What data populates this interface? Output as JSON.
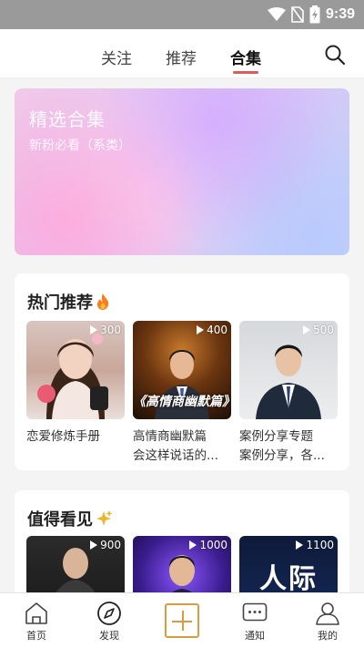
{
  "status_bar": {
    "time": "9:39"
  },
  "top_nav": {
    "tabs": [
      {
        "label": "关注"
      },
      {
        "label": "推荐"
      },
      {
        "label": "合集"
      }
    ],
    "active_tab": "合集"
  },
  "banner": {
    "title": "精选合集",
    "subtitle": "新粉必看（系类）"
  },
  "sections": [
    {
      "title": "热门推荐",
      "title_icon": "fire-icon",
      "items": [
        {
          "count": "300",
          "caption_line1": "恋爱修炼手册",
          "caption_line2": ""
        },
        {
          "count": "400",
          "caption_line1": "高情商幽默篇",
          "caption_line2": "会这样说话的...",
          "thumb_text": "《高情商幽默篇》"
        },
        {
          "count": "500",
          "caption_line1": "案例分享专题",
          "caption_line2": "案例分享，各..."
        }
      ]
    },
    {
      "title": "值得看见",
      "title_icon": "sparkle-icon",
      "items": [
        {
          "count": "900"
        },
        {
          "count": "1000"
        },
        {
          "count": "1100",
          "thumb_text": "人际"
        }
      ]
    }
  ],
  "bottom_nav": [
    {
      "label": "首页",
      "icon": "home-icon"
    },
    {
      "label": "发现",
      "icon": "compass-icon"
    },
    {
      "label": "",
      "icon": "plus-icon"
    },
    {
      "label": "通知",
      "icon": "message-icon"
    },
    {
      "label": "我的",
      "icon": "profile-icon"
    }
  ],
  "colors": {
    "accent": "#e05a5a",
    "plus": "#d99b3e",
    "status_bar": "#9a9a9a"
  }
}
